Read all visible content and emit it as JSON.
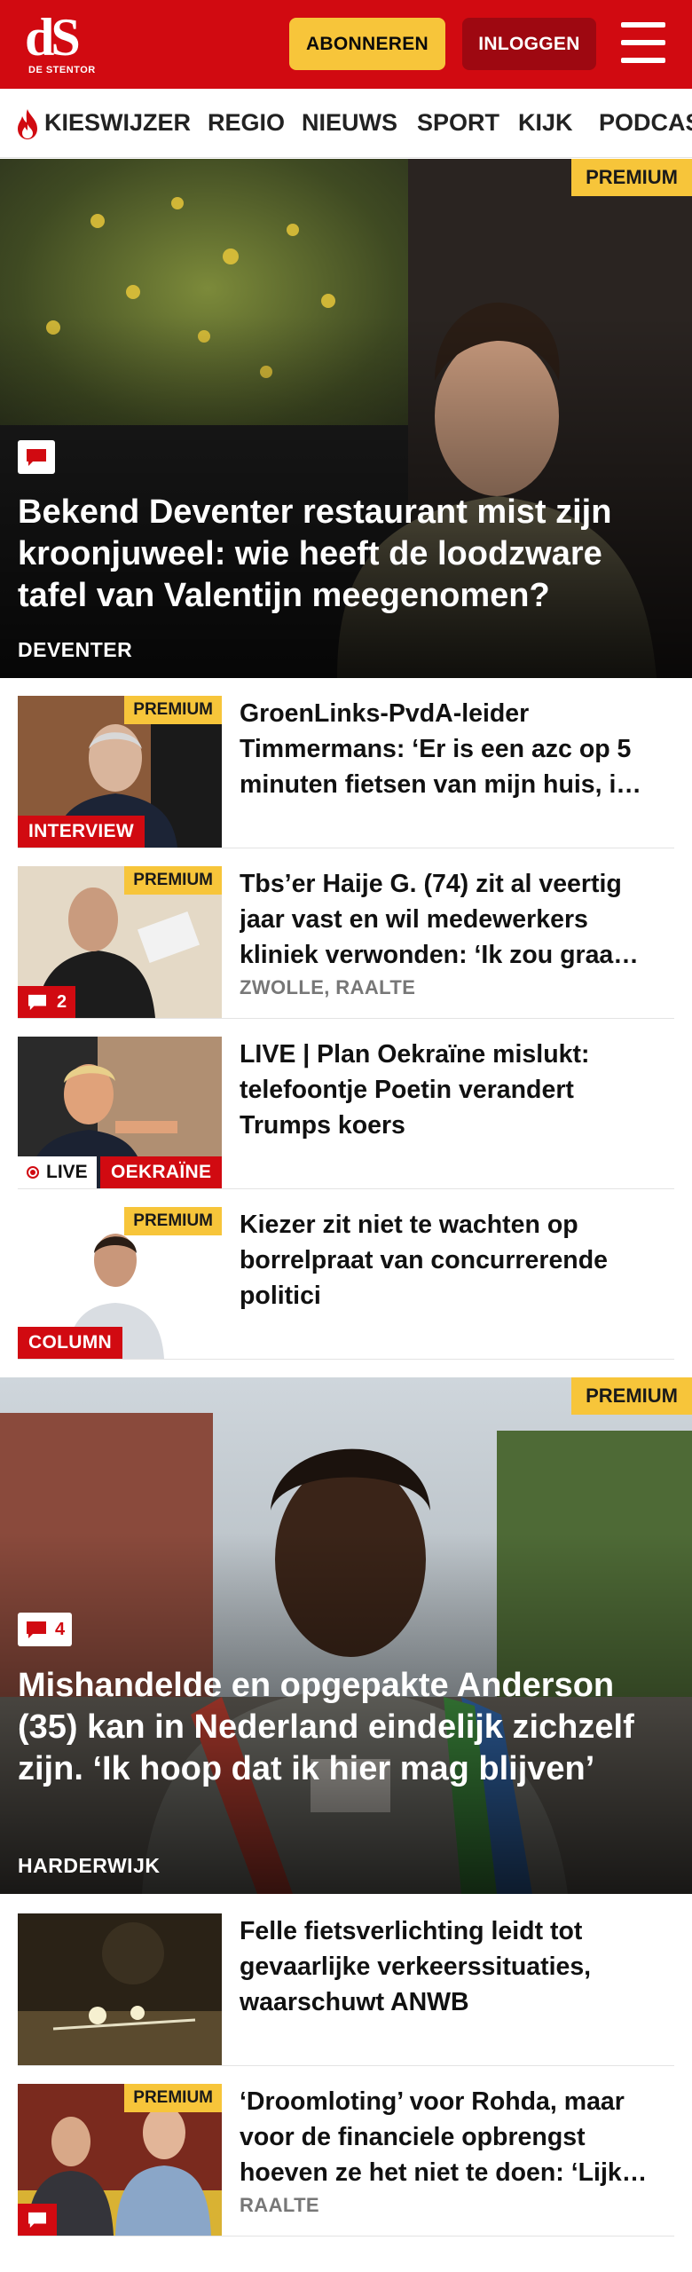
{
  "header": {
    "logo_mark": "dS",
    "logo_name": "DE STENTOR",
    "subscribe_label": "ABONNEREN",
    "login_label": "INLOGGEN",
    "menu_icon": "hamburger-icon"
  },
  "nav": {
    "items": [
      {
        "label": "KIESWIJZER",
        "icon": "flame-icon"
      },
      {
        "label": "REGIO"
      },
      {
        "label": "NIEUWS"
      },
      {
        "label": "SPORT"
      },
      {
        "label": "KIJK"
      },
      {
        "label": "PODCAST"
      }
    ]
  },
  "hero1": {
    "premium": "PREMIUM",
    "comment_icon": "comment-icon",
    "title": "Bekend Deventer restaurant mist zijn kroonjuweel: wie heeft de loodzware tafel van Valentijn meegenomen?",
    "section": "DEVENTER"
  },
  "articles1": [
    {
      "title": "GroenLinks-PvdA-leider Timmermans: ‘Er is een azc op 5 minuten fietsen van mijn huis, i…",
      "premium": "PREMIUM",
      "label": "INTERVIEW"
    },
    {
      "title": "Tbs’er Haije G. (74) zit al veertig jaar vast en wil medewerkers kliniek verwonden: ‘Ik zou graa…",
      "premium": "PREMIUM",
      "comments": "2",
      "meta": "ZWOLLE, RAALTE"
    },
    {
      "title": "LIVE | Plan Oekraïne mislukt: telefoontje Poetin verandert Trumps koers",
      "live": "LIVE",
      "label": "OEKRAÏNE"
    },
    {
      "title": "Kiezer zit niet te wachten op borrelpraat van concurrerende politici",
      "premium": "PREMIUM",
      "label": "COLUMN"
    }
  ],
  "hero2": {
    "premium": "PREMIUM",
    "comments": "4",
    "title": "Mishandelde en opgepakte Anderson (35) kan in Nederland eindelijk zichzelf zijn. ‘Ik hoop dat ik hier mag blijven’",
    "section": "HARDERWIJK"
  },
  "articles2": [
    {
      "title": "Felle fietsverlichting leidt tot gevaarlijke verkeerssituaties, waarschuwt ANWB"
    },
    {
      "title": "‘Droomloting’ voor Rohda, maar voor de financiele opbrengst hoeven ze het niet te doen: ‘Lijk…",
      "premium": "PREMIUM",
      "meta": "RAALTE"
    }
  ],
  "colors": {
    "brand_red": "#d10a11",
    "premium_yellow": "#f7c53a",
    "login_dark_red": "#9e0811"
  }
}
